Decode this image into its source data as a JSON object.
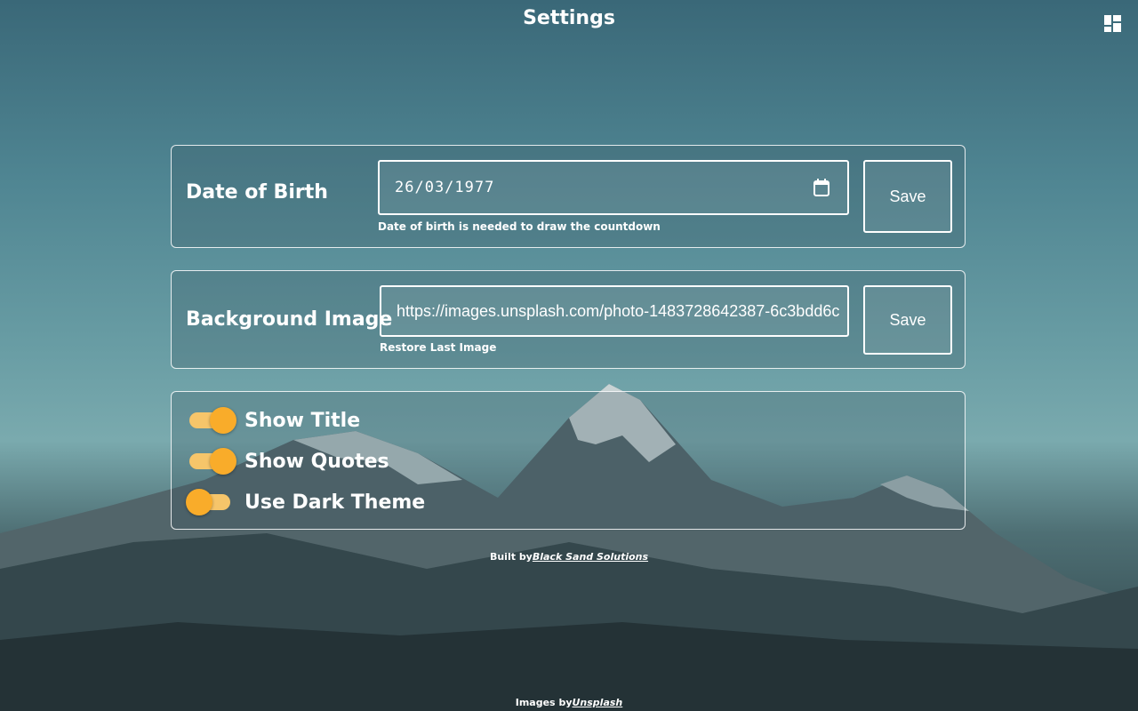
{
  "header": {
    "title": "Settings"
  },
  "date_of_birth": {
    "label": "Date of Birth",
    "value": "26/03/1977",
    "helper": "Date of birth is needed to draw the countdown",
    "save_label": "Save"
  },
  "background_image": {
    "label": "Background Image",
    "value": "https://images.unsplash.com/photo-1483728642387-6c3bdd6c",
    "helper": "Restore Last Image",
    "save_label": "Save"
  },
  "toggles": [
    {
      "label": "Show Title",
      "on": true
    },
    {
      "label": "Show Quotes",
      "on": true
    },
    {
      "label": "Use Dark Theme",
      "on": false
    }
  ],
  "footer": {
    "built_by_prefix": "Built by",
    "built_by_link": "Black Sand Solutions",
    "images_prefix": "Images by",
    "images_link": "Unsplash"
  },
  "colors": {
    "toggle_thumb": "#f9ac2a",
    "toggle_track": "#f6c56a",
    "sky_top": "#3a6878"
  },
  "icons": {
    "layout": "dashboard-layout-icon",
    "calendar": "calendar-icon"
  }
}
